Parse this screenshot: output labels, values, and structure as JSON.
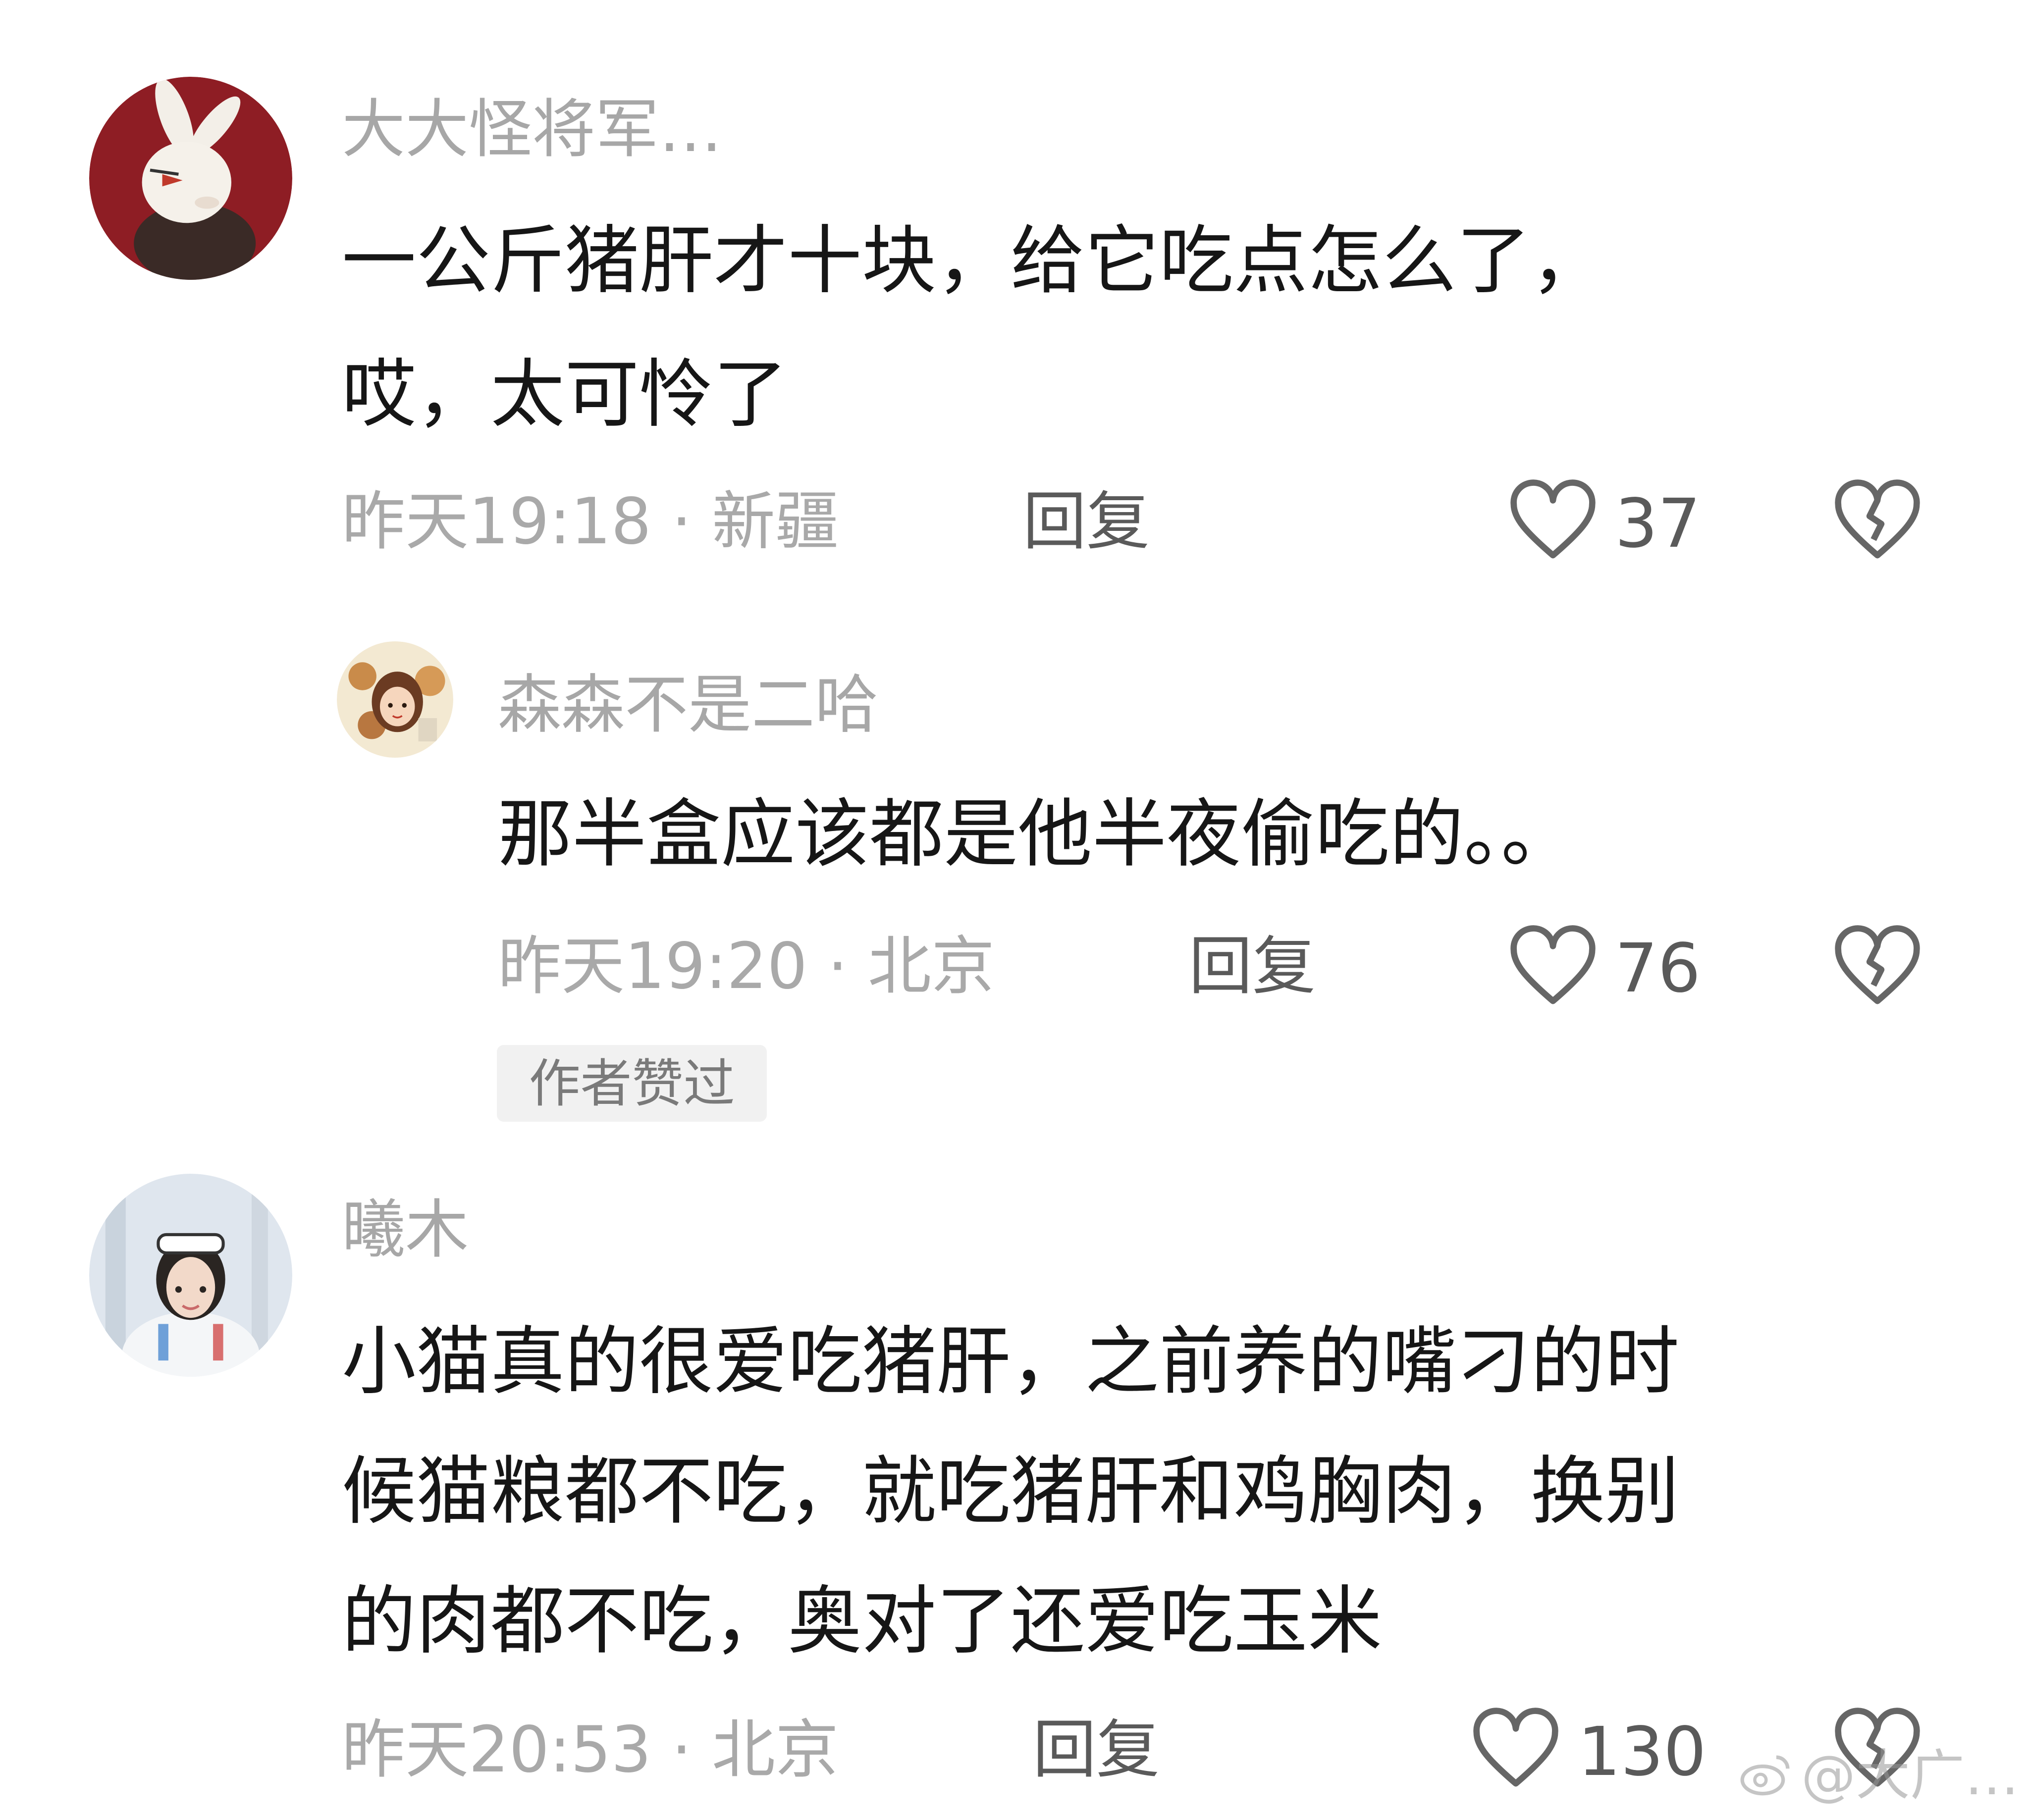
{
  "comments": [
    {
      "username": "大大怪将军…",
      "content_lines": [
        "一公斤猪肝才十块，给它吃点怎么了，",
        "哎，太可怜了"
      ],
      "meta": "昨天19:18 · 新疆",
      "reply_label": "回复",
      "likes": "37"
    },
    {
      "username": "森森不是二哈",
      "content_lines": [
        "那半盒应该都是他半夜偷吃的。。"
      ],
      "meta": "昨天19:20 · 北京",
      "reply_label": "回复",
      "likes": "76",
      "badge": "作者赞过"
    },
    {
      "username": "曦木",
      "content_lines": [
        "小猫真的很爱吃猪肝，之前养的嘴刁的时",
        "候猫粮都不吃，就吃猪肝和鸡胸肉，换别",
        "的肉都不吃，奥对了还爱吃玉米"
      ],
      "meta": "昨天20:53 · 北京",
      "reply_label": "回复",
      "likes": "130"
    }
  ],
  "watermark": {
    "text": "@大广…",
    "icon": "weibo-icon"
  },
  "colors": {
    "username": "#a7a7a7",
    "content": "#161616",
    "meta": "#a9a9a9",
    "icon": "#666666",
    "badge_bg": "#f1f1f1"
  }
}
